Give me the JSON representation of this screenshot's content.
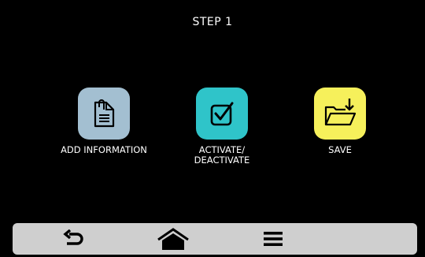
{
  "header": {
    "title": "STEP 1"
  },
  "actions": [
    {
      "label": "ADD INFORMATION",
      "icon": "document-icon",
      "color": "#a3bfd1"
    },
    {
      "label": "ACTIVATE/ DEACTIVATE",
      "icon": "checkbox-icon",
      "color": "#2fc4c9"
    },
    {
      "label": "SAVE",
      "icon": "folder-download-icon",
      "color": "#f6f05b"
    }
  ],
  "navbar": {
    "items": [
      {
        "icon": "back-arrow-icon"
      },
      {
        "icon": "home-icon"
      },
      {
        "icon": "menu-icon"
      }
    ],
    "color": "#cfcfcf"
  }
}
